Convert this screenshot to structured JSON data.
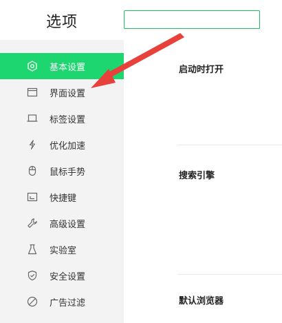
{
  "header": {
    "title": "选项",
    "search_value": ""
  },
  "sidebar": {
    "items": [
      {
        "label": "基本设置",
        "icon": "gear-hex-icon",
        "active": true
      },
      {
        "label": "界面设置",
        "icon": "window-icon",
        "active": false
      },
      {
        "label": "标签设置",
        "icon": "tab-icon",
        "active": false
      },
      {
        "label": "优化加速",
        "icon": "lightning-icon",
        "active": false
      },
      {
        "label": "鼠标手势",
        "icon": "mouse-icon",
        "active": false
      },
      {
        "label": "快捷键",
        "icon": "keyboard-icon",
        "active": false
      },
      {
        "label": "高级设置",
        "icon": "wrench-icon",
        "active": false
      },
      {
        "label": "实验室",
        "icon": "flask-icon",
        "active": false
      },
      {
        "label": "安全设置",
        "icon": "shield-icon",
        "active": false
      },
      {
        "label": "广告过滤",
        "icon": "block-icon",
        "active": false
      }
    ]
  },
  "main": {
    "sections": [
      {
        "title": "启动时打开"
      },
      {
        "title": "搜索引擎"
      },
      {
        "title": "默认浏览器"
      }
    ]
  },
  "colors": {
    "accent": "#1ed66f",
    "search_border": "#1fb85a",
    "arrow": "#e8413c"
  }
}
